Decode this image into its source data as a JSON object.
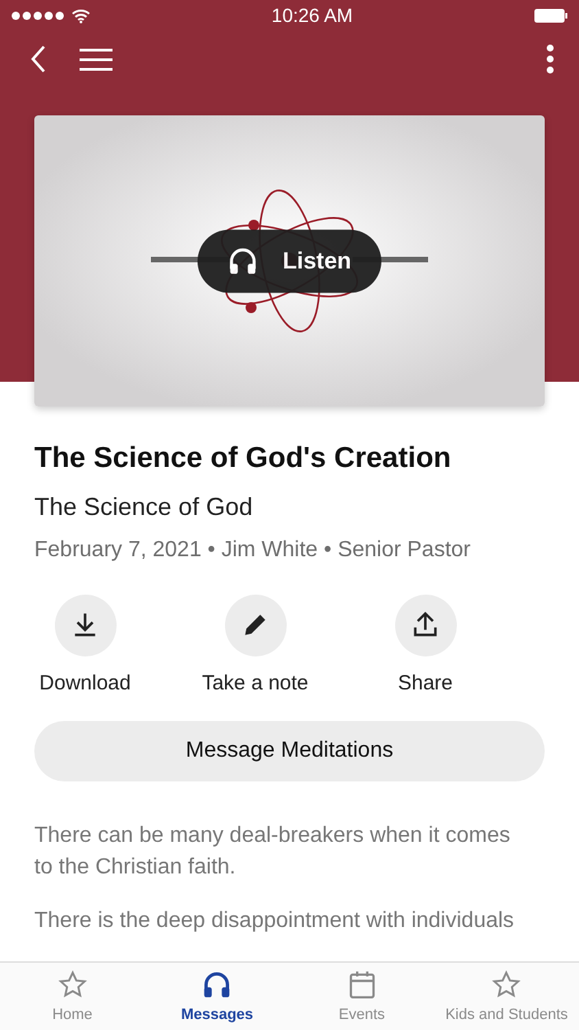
{
  "status_bar": {
    "time": "10:26 AM"
  },
  "message": {
    "listen_label": "Listen",
    "title": "The Science of God's Creation",
    "series": "The Science of God",
    "meta": "February 7, 2021 • Jim White • Senior Pastor"
  },
  "actions": [
    {
      "kind": "download",
      "label": "Download"
    },
    {
      "kind": "note",
      "label": "Take a note"
    },
    {
      "kind": "share",
      "label": "Share"
    }
  ],
  "meditations_button": "Message Meditations",
  "body": [
    "There can be many deal-breakers when it comes to the Christian faith.",
    "There is the deep disappointment with individuals"
  ],
  "tab_bar": [
    {
      "kind": "star",
      "label": "Home",
      "selected": false
    },
    {
      "kind": "headphones",
      "label": "Messages",
      "selected": true
    },
    {
      "kind": "calendar",
      "label": "Events",
      "selected": false
    },
    {
      "kind": "star",
      "label": "Kids and Students",
      "selected": false
    }
  ]
}
